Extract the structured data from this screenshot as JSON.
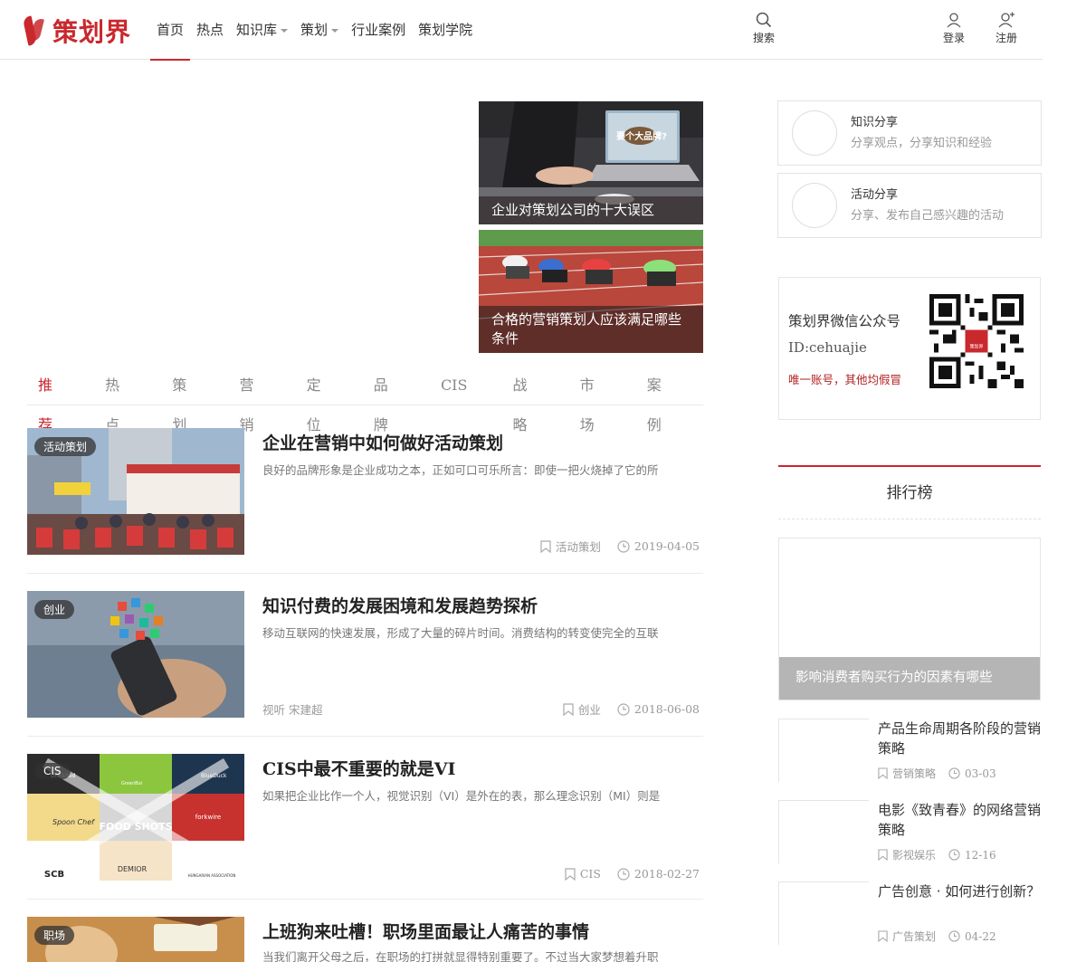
{
  "header": {
    "logo_text": "策划界",
    "nav": [
      {
        "label": "首页",
        "active": true,
        "dropdown": false
      },
      {
        "label": "热点",
        "active": false,
        "dropdown": false
      },
      {
        "label": "知识库",
        "active": false,
        "dropdown": true
      },
      {
        "label": "策划",
        "active": false,
        "dropdown": true
      },
      {
        "label": "行业案例",
        "active": false,
        "dropdown": false
      },
      {
        "label": "策划学院",
        "active": false,
        "dropdown": false
      }
    ],
    "search_label": "搜索",
    "login_label": "登录",
    "register_label": "注册",
    "accent": "#c9282d"
  },
  "slider": {
    "thumbs": [
      {
        "caption": "企业对策划公司的十大误区",
        "screen_text": "要个大品牌?"
      },
      {
        "caption": "合格的营销策划人应该满足哪些条件"
      }
    ]
  },
  "tabs": [
    "推荐",
    "热点",
    "策划",
    "营销",
    "定位",
    "品牌",
    "CIS",
    "战略",
    "市场",
    "案例"
  ],
  "articles": [
    {
      "badge": "活动策划",
      "title": "企业在营销中如何做好活动策划",
      "desc": "良好的品牌形象是企业成功之本，正如可口可乐所言：即使一把火烧掉了它的所",
      "author": "",
      "category": "活动策划",
      "date": "2019-04-05"
    },
    {
      "badge": "创业",
      "title": "知识付费的发展困境和发展趋势探析",
      "desc": "移动互联网的快速发展，形成了大量的碎片时间。消费结构的转变使完全的互联",
      "author": "视听 宋建超",
      "category": "创业",
      "date": "2018-06-08"
    },
    {
      "badge": "CIS",
      "title": "CIS中最不重要的就是VI",
      "desc": "如果把企业比作一个人，视觉识别（VI）是外在的表，那么理念识别（MI）则是",
      "author": "",
      "category": "CIS",
      "date": "2018-02-27",
      "logo_texts": [
        "DrinkRed",
        "GreenBoi",
        "BlueDuck",
        "Spoon Chef",
        "FOOD SHOTS",
        "forkwire",
        "SCB",
        "DEMIOR",
        "HUNGARIAN ASSOCIATION"
      ]
    },
    {
      "badge": "职场",
      "title": "上班狗来吐槽！职场里面最让人痛苦的事情",
      "desc": "当我们离开父母之后，在职场的打拼就显得特别重要了。不过当大家梦想着升职",
      "author": "",
      "category": "",
      "date": ""
    }
  ],
  "sidebar": {
    "shares": [
      {
        "title": "知识分享",
        "desc": "分享观点，分享知识和经验"
      },
      {
        "title": "活动分享",
        "desc": "分享、发布自己感兴趣的活动"
      }
    ],
    "wechat": {
      "title": "策划界微信公众号",
      "id": "ID:cehuajie",
      "note": "唯一账号，其他均假冒",
      "qr_label": "策划界"
    },
    "ranking": {
      "title": "排行榜",
      "top_caption": "影响消费者购买行为的因素有哪些",
      "items": [
        {
          "title": "产品生命周期各阶段的营销策略",
          "category": "营销策略",
          "date": "03-03"
        },
        {
          "title": "电影《致青春》的网络营销策略",
          "category": "影视娱乐",
          "date": "12-16"
        },
        {
          "title": "广告创意 · 如何进行创新？",
          "category": "广告策划",
          "date": "04-22"
        }
      ]
    }
  }
}
